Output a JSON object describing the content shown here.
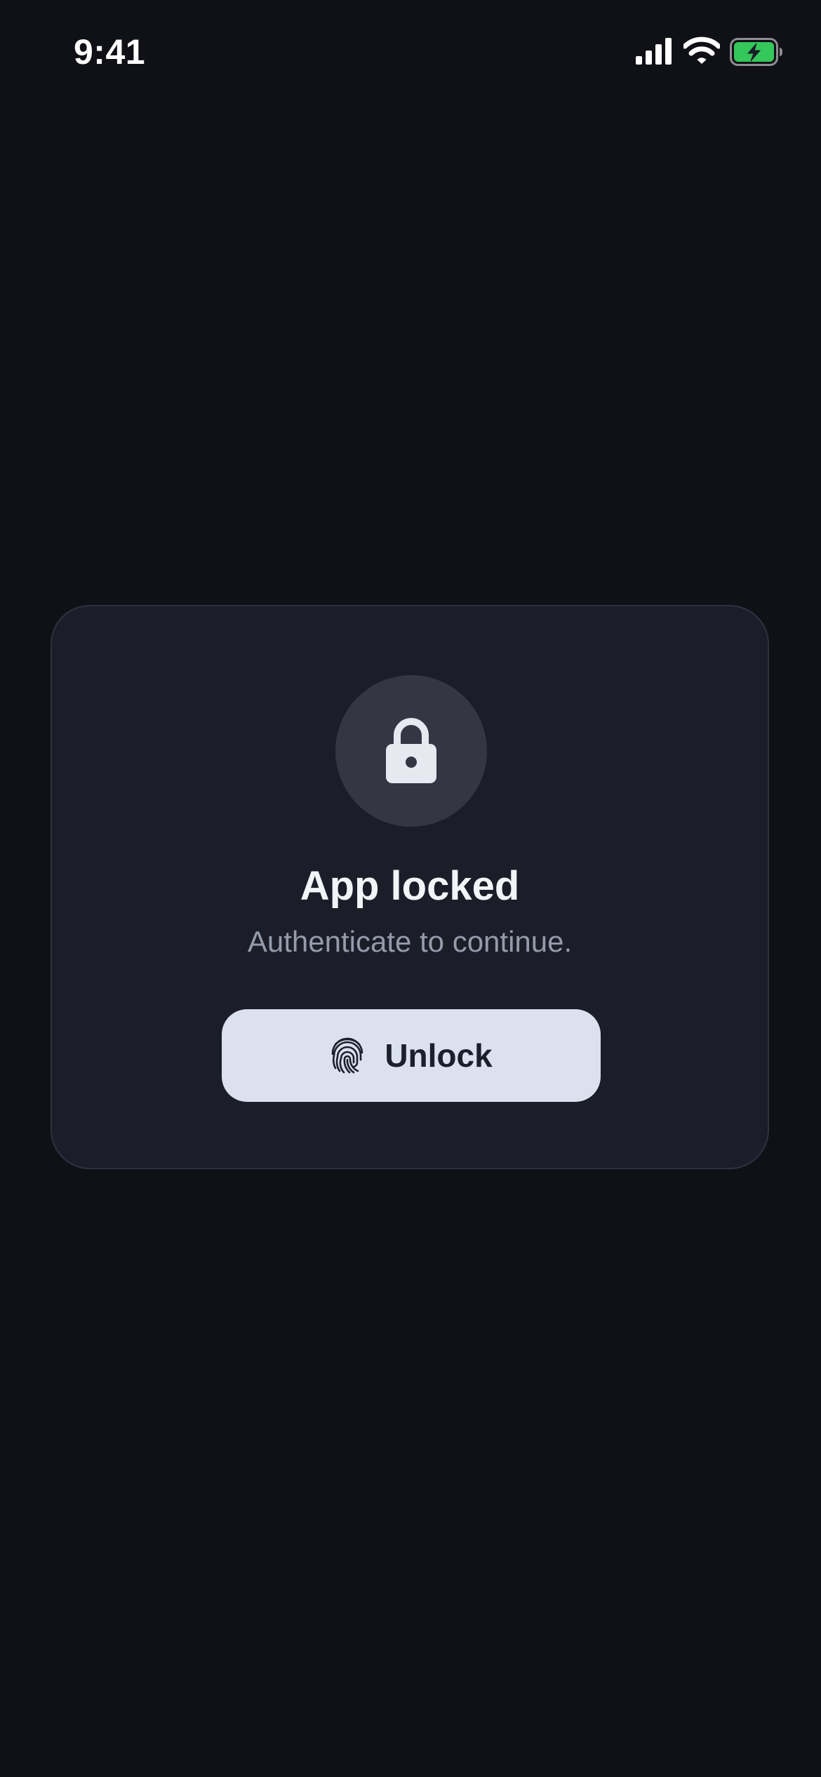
{
  "status_bar": {
    "time": "9:41",
    "signal_icon": "cellular-signal-icon",
    "wifi_icon": "wifi-icon",
    "battery_icon": "battery-charging-icon",
    "battery_color": "#34c759"
  },
  "lock_card": {
    "icon": "lock-icon",
    "title": "App locked",
    "subtitle": "Authenticate to continue.",
    "unlock_button": {
      "icon": "fingerprint-icon",
      "label": "Unlock"
    }
  },
  "colors": {
    "background": "#101116",
    "card": "#1b1d28",
    "button": "#dbe1ee"
  }
}
